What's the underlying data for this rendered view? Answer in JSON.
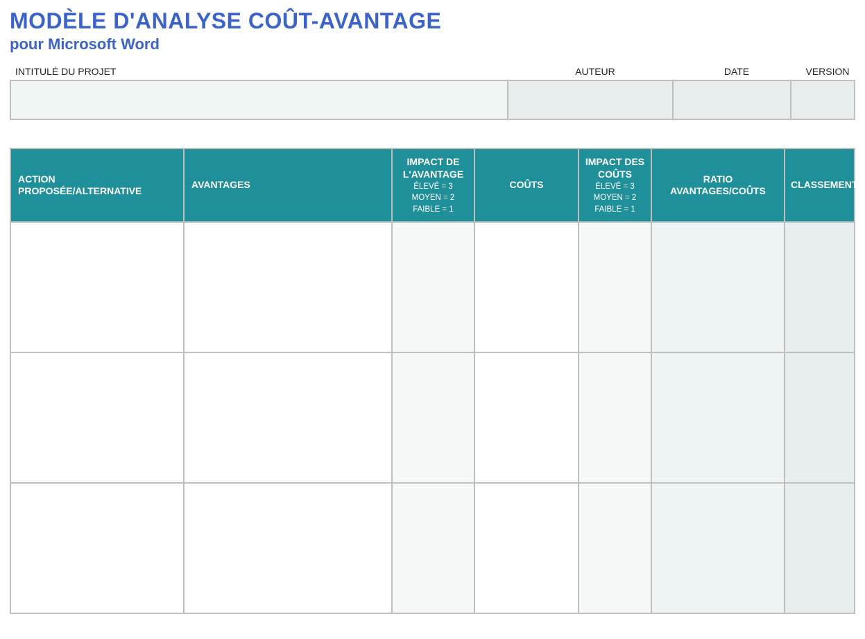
{
  "header": {
    "title": "MODÈLE D'ANALYSE COÛT-AVANTAGE",
    "subtitle": "pour Microsoft Word"
  },
  "meta": {
    "labels": {
      "project": "INTITULÉ DU PROJET",
      "author": "AUTEUR",
      "date": "DATE",
      "version": "VERSION"
    },
    "values": {
      "project": "",
      "author": "",
      "date": "",
      "version": ""
    }
  },
  "table": {
    "columns": {
      "action": {
        "label": "ACTION PROPOSÉE/ALTERNATIVE"
      },
      "advantages": {
        "label": "AVANTAGES"
      },
      "adv_impact": {
        "label": "IMPACT DE L'AVANTAGE",
        "sub1": "ÉLEVÉ = 3",
        "sub2": "MOYEN = 2",
        "sub3": "FAIBLE = 1"
      },
      "costs": {
        "label": "COÛTS"
      },
      "cost_impact": {
        "label": "IMPACT DES COÛTS",
        "sub1": "ÉLEVÉ = 3",
        "sub2": "MOYEN = 2",
        "sub3": "FAIBLE = 1"
      },
      "ratio": {
        "label": "RATIO AVANTAGES/COÛTS"
      },
      "rank": {
        "label": "CLASSEMENT"
      }
    },
    "rows": [
      {
        "action": "",
        "advantages": "",
        "adv_impact": "",
        "costs": "",
        "cost_impact": "",
        "ratio": "",
        "rank": ""
      },
      {
        "action": "",
        "advantages": "",
        "adv_impact": "",
        "costs": "",
        "cost_impact": "",
        "ratio": "",
        "rank": ""
      },
      {
        "action": "",
        "advantages": "",
        "adv_impact": "",
        "costs": "",
        "cost_impact": "",
        "ratio": "",
        "rank": ""
      }
    ]
  }
}
